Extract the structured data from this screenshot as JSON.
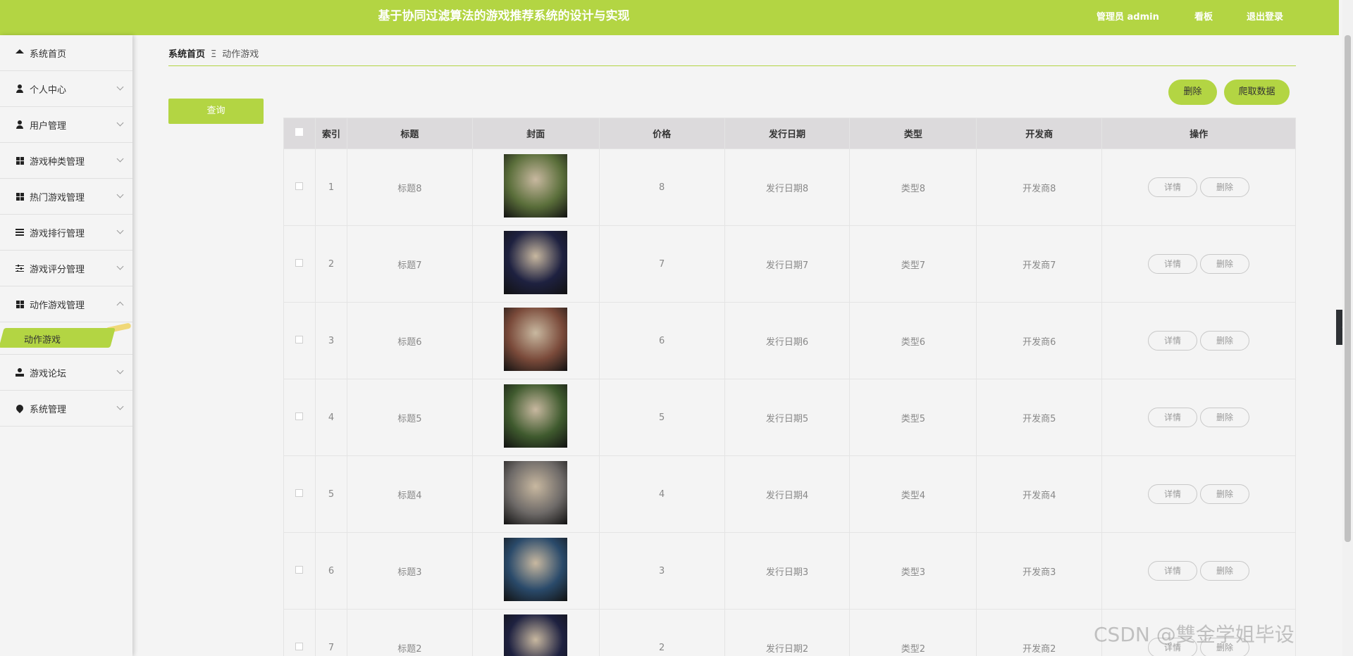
{
  "header": {
    "title": "基于协同过滤算法的游戏推荐系统的设计与实现",
    "admin_label": "管理员 admin",
    "board_label": "看板",
    "logout_label": "退出登录"
  },
  "sidebar": {
    "items": [
      {
        "label": "系统首页",
        "icon": "home-icon"
      },
      {
        "label": "个人中心",
        "icon": "user-icon"
      },
      {
        "label": "用户管理",
        "icon": "user-icon"
      },
      {
        "label": "游戏种类管理",
        "icon": "grid-icon"
      },
      {
        "label": "热门游戏管理",
        "icon": "grid-icon"
      },
      {
        "label": "游戏排行管理",
        "icon": "list-icon"
      },
      {
        "label": "游戏评分管理",
        "icon": "sliders-icon"
      },
      {
        "label": "动作游戏管理",
        "icon": "grid-icon"
      },
      {
        "label": "游戏论坛",
        "icon": "forum-icon"
      },
      {
        "label": "系统管理",
        "icon": "pin-icon"
      }
    ],
    "active_sub": "动作游戏"
  },
  "breadcrumb": {
    "home": "系统首页",
    "separator": "Ξ",
    "current": "动作游戏"
  },
  "toolbar": {
    "query_label": "查询",
    "delete_label": "删除",
    "crawl_label": "爬取数据"
  },
  "table": {
    "headers": [
      "索引",
      "标题",
      "封面",
      "价格",
      "发行日期",
      "类型",
      "开发商",
      "操作"
    ],
    "rows": [
      {
        "index": "1",
        "title": "标题8",
        "price": "8",
        "date": "发行日期8",
        "type": "类型8",
        "dev": "开发商8",
        "cover_color": "#5a6e3a"
      },
      {
        "index": "2",
        "title": "标题7",
        "price": "7",
        "date": "发行日期7",
        "type": "类型7",
        "dev": "开发商7",
        "cover_color": "#1e2140"
      },
      {
        "index": "3",
        "title": "标题6",
        "price": "6",
        "date": "发行日期6",
        "type": "类型6",
        "dev": "开发商6",
        "cover_color": "#7a4a3a"
      },
      {
        "index": "4",
        "title": "标题5",
        "price": "5",
        "date": "发行日期5",
        "type": "类型5",
        "dev": "开发商5",
        "cover_color": "#3f5a2e"
      },
      {
        "index": "5",
        "title": "标题4",
        "price": "4",
        "date": "发行日期4",
        "type": "类型4",
        "dev": "开发商4",
        "cover_color": "#6e6a68"
      },
      {
        "index": "6",
        "title": "标题3",
        "price": "3",
        "date": "发行日期3",
        "type": "类型3",
        "dev": "开发商3",
        "cover_color": "#2a4a6a"
      },
      {
        "index": "7",
        "title": "标题2",
        "price": "2",
        "date": "发行日期2",
        "type": "类型2",
        "dev": "开发商2",
        "cover_color": "#1e2140"
      }
    ],
    "detail_label": "详情",
    "row_delete_label": "删除"
  },
  "watermark": "CSDN @雙金学姐毕设",
  "colors": {
    "accent": "#b3d543"
  }
}
